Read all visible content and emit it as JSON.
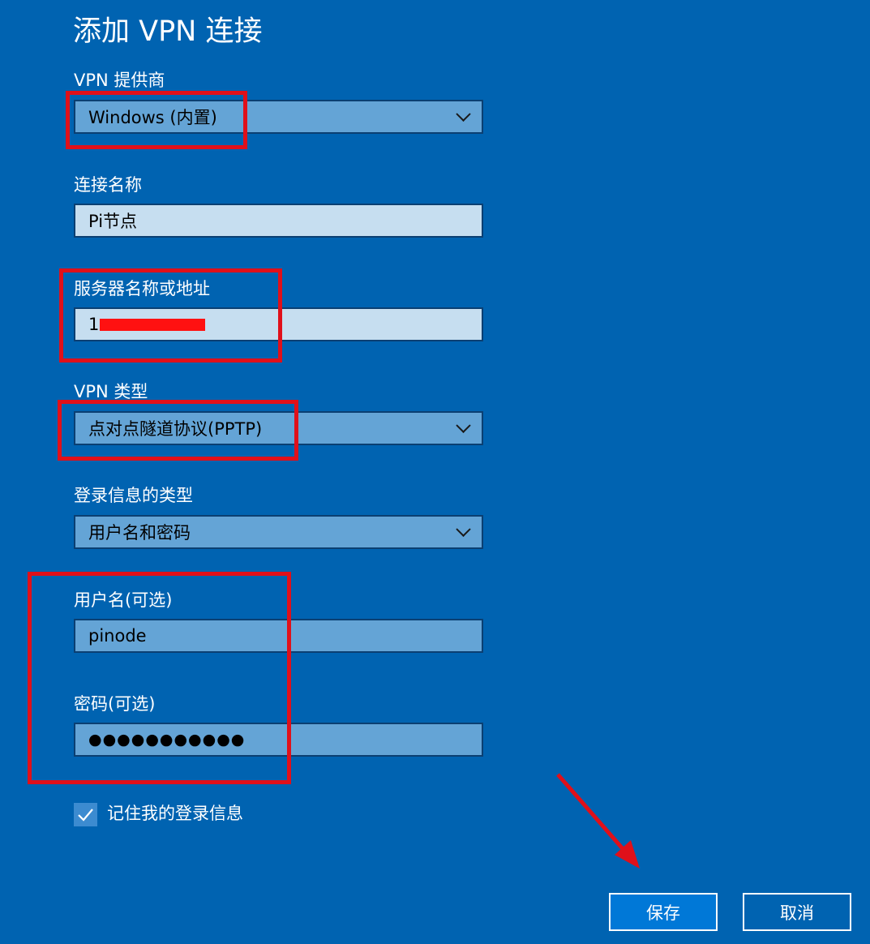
{
  "page": {
    "title": "添加 VPN 连接"
  },
  "form": {
    "vpn_provider": {
      "label": "VPN 提供商",
      "value": "Windows (内置)"
    },
    "connection_name": {
      "label": "连接名称",
      "value": "Pi节点"
    },
    "server": {
      "label": "服务器名称或地址",
      "value": "1"
    },
    "vpn_type": {
      "label": "VPN 类型",
      "value": "点对点隧道协议(PPTP)"
    },
    "signin_type": {
      "label": "登录信息的类型",
      "value": "用户名和密码"
    },
    "username": {
      "label": "用户名(可选)",
      "value": "pinode"
    },
    "password": {
      "label": "密码(可选)",
      "value": "●●●●●●●●●●●"
    },
    "remember": {
      "label": "记住我的登录信息",
      "checked": true
    }
  },
  "buttons": {
    "save": "保存",
    "cancel": "取消"
  },
  "icons": {
    "dropdown": "chevron-down-icon",
    "check": "checkmark-icon"
  },
  "colors": {
    "background": "#0063b1",
    "field_dark": "#64a4d6",
    "field_light": "#c6def0",
    "primary_button": "#0078d7",
    "annotation_red": "#e0101a"
  }
}
